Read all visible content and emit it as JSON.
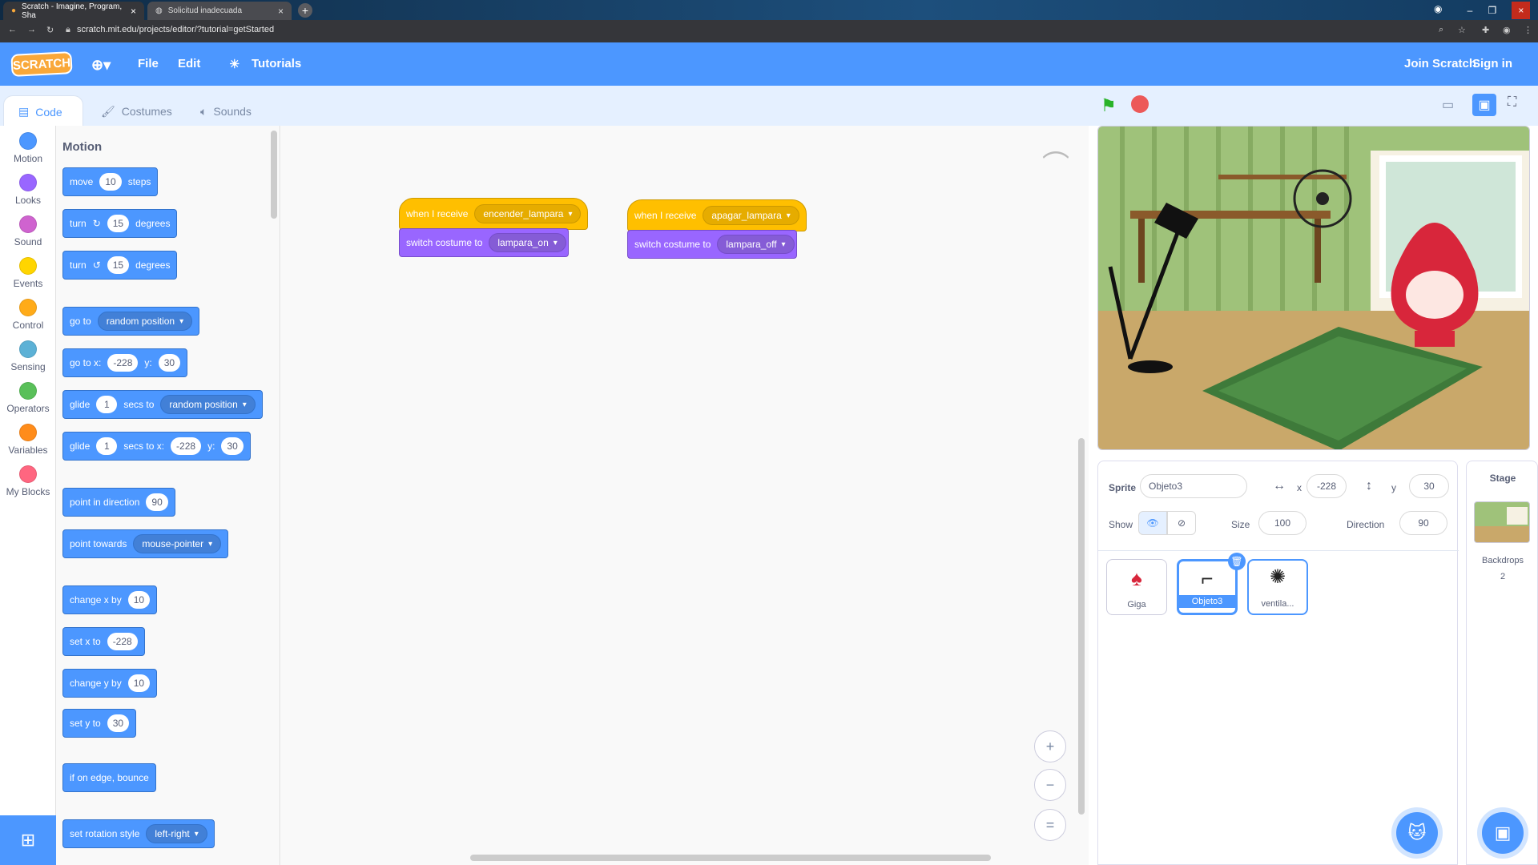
{
  "browser": {
    "tabs": [
      {
        "title": "Scratch - Imagine, Program, Sha"
      },
      {
        "title": "Solicitud inadecuada"
      }
    ],
    "url": "scratch.mit.edu/projects/editor/?tutorial=getStarted"
  },
  "menubar": {
    "logo": "SCRATCH",
    "file": "File",
    "edit": "Edit",
    "tutorials": "Tutorials",
    "join": "Join Scratch",
    "signin": "Sign in"
  },
  "editor_tabs": {
    "code": "Code",
    "costumes": "Costumes",
    "sounds": "Sounds"
  },
  "categories": [
    {
      "label": "Motion",
      "color": "#4c97ff"
    },
    {
      "label": "Looks",
      "color": "#9966ff"
    },
    {
      "label": "Sound",
      "color": "#cf63cf"
    },
    {
      "label": "Events",
      "color": "#ffd500"
    },
    {
      "label": "Control",
      "color": "#ffab19"
    },
    {
      "label": "Sensing",
      "color": "#5cb1d6"
    },
    {
      "label": "Operators",
      "color": "#59c059"
    },
    {
      "label": "Variables",
      "color": "#ff8c1a"
    },
    {
      "label": "My Blocks",
      "color": "#ff6680"
    }
  ],
  "palette": {
    "title": "Motion",
    "move": {
      "a": "move",
      "v": "10",
      "b": "steps"
    },
    "turn_right": {
      "a": "turn",
      "v": "15",
      "b": "degrees"
    },
    "turn_left": {
      "a": "turn",
      "v": "15",
      "b": "degrees"
    },
    "goto": {
      "a": "go to",
      "dd": "random position"
    },
    "goto_xy": {
      "a": "go to x:",
      "x": "-228",
      "y_label": "y:",
      "y": "30"
    },
    "glide_to": {
      "a": "glide",
      "v": "1",
      "b": "secs to",
      "dd": "random position"
    },
    "glide_xy": {
      "a": "glide",
      "v": "1",
      "b": "secs to x:",
      "x": "-228",
      "y_label": "y:",
      "y": "30"
    },
    "point_dir": {
      "a": "point in direction",
      "v": "90"
    },
    "point_towards": {
      "a": "point towards",
      "dd": "mouse-pointer"
    },
    "change_x": {
      "a": "change x by",
      "v": "10"
    },
    "set_x": {
      "a": "set x to",
      "v": "-228"
    },
    "change_y": {
      "a": "change y by",
      "v": "10"
    },
    "set_y": {
      "a": "set y to",
      "v": "30"
    },
    "bounce": {
      "a": "if on edge, bounce"
    },
    "rotation": {
      "a": "set rotation style",
      "dd": "left-right"
    }
  },
  "scripts": [
    {
      "hat": "when I receive",
      "msg": "encender_lampara",
      "action": "switch costume to",
      "costume": "lampara_on"
    },
    {
      "hat": "when I receive",
      "msg": "apagar_lampara",
      "action": "switch costume to",
      "costume": "lampara_off"
    }
  ],
  "zoom": {
    "in": "+",
    "out": "−",
    "reset": "="
  },
  "sprite_info": {
    "sprite_label": "Sprite",
    "sprite_name": "Objeto3",
    "x_label": "x",
    "x": "-228",
    "y_label": "y",
    "y": "30",
    "show_label": "Show",
    "size_label": "Size",
    "size": "100",
    "direction_label": "Direction",
    "direction": "90"
  },
  "sprites": [
    {
      "name": "Giga"
    },
    {
      "name": "Objeto3"
    },
    {
      "name": "ventila..."
    }
  ],
  "stage_panel": {
    "title": "Stage",
    "backdrops_label": "Backdrops",
    "backdrops_count": "2"
  }
}
